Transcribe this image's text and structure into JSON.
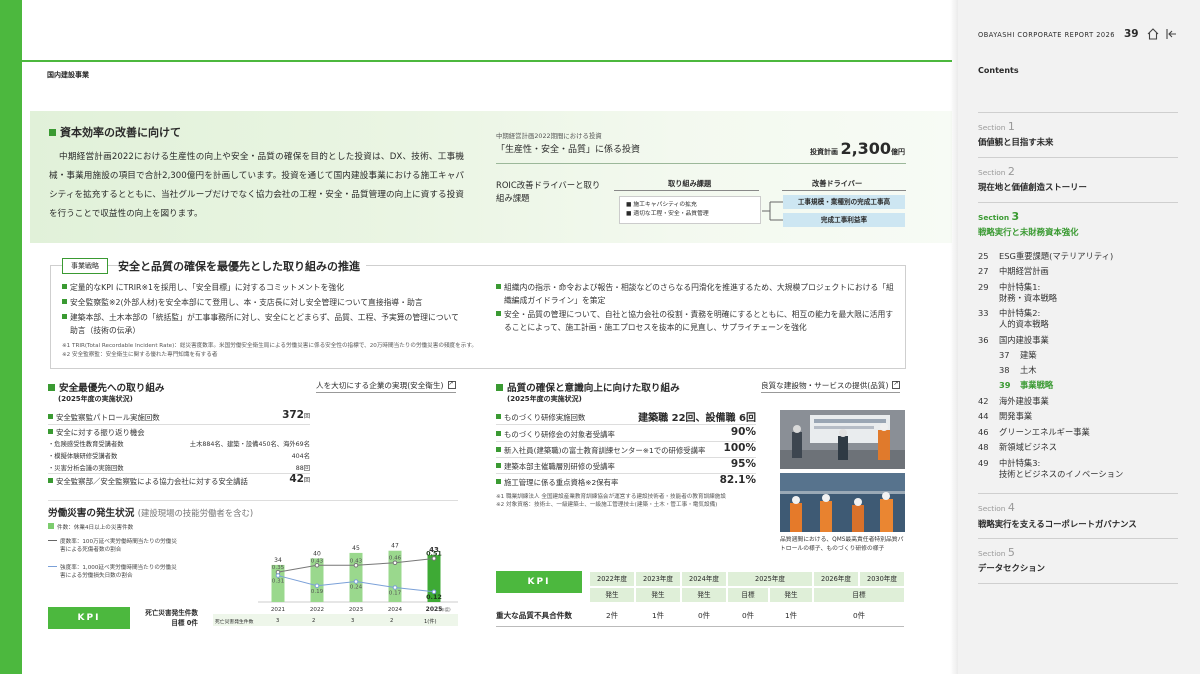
{
  "section_label": "国内建設事業",
  "investment": {
    "title": "資本効率の改善に向けて",
    "body": "中期経営計画2022における生産性の向上や安全・品質の確保を目的とした投資は、DX、技術、工事機械・事業用施設の項目で合計2,300億円を計画しています。投資を通じて国内建設事業における施工キャパシティを拡充するとともに、当社グループだけでなく協力会社の工程・安全・品質管理の向上に資する投資を行うことで収益性の向上を図ります。",
    "caption": "中期経営計画2022期間における投資",
    "heading": "「生産性・安全・品質」に係る投資",
    "plan_label": "投資計画",
    "plan_value": "2,300",
    "plan_unit": "億円",
    "roic_title": "ROIC改善ドライバーと取り組み課題",
    "col_issue": "取り組み課題",
    "col_driver": "改善ドライバー",
    "issues": [
      "施工キャパシティの拡充",
      "適切な工程・安全・品質管理"
    ],
    "drivers": [
      "工事規模・業種別の完成工事高",
      "完成工事利益率"
    ]
  },
  "strategy": {
    "tag": "事業戦略",
    "title": "安全と品質の確保を最優先とした取り組みの推進",
    "left_bullets": [
      "定量的なKPI にTRIR※1を採用し、「安全目標」に対するコミットメントを強化",
      "安全監察監※2(外部人材)を安全本部にて登用し、本・支店長に対し安全管理について直接指導・助言",
      "建築本部、土木本部の「統括監」が工事事務所に対し、安全にとどまらず、品質、工程、予実算の管理について助言（技術の伝承）"
    ],
    "right_bullets": [
      "組織内の指示・命令および報告・相談などのさらなる円滑化を推進するため、大規模プロジェクトにおける「組織編成ガイドライン」を策定",
      "安全・品質の管理について、自社と協力会社の役割・責務を明確にするとともに、相互の能力を最大限に活用することによって、施工計画・施工プロセスを抜本的に見直し、サプライチェーンを強化"
    ],
    "notes": [
      "※1 TRIR(Total Recordable Incident Rate)：総災害度数率。米国労働安全衛生局による労働災害に係る安全性の指標で、20万時間当たりの労働災害の頻度を示す。",
      "※2 安全監察監：安全衛生に関する優れた専門知識を有する者"
    ]
  },
  "safety": {
    "title": "安全最優先への取り組み",
    "subtitle": "(2025年度の実施状況)",
    "link": "人を大切にする企業の実現(安全衛生)",
    "rows": [
      {
        "label": "安全監察監パトロール実施回数",
        "value": "372",
        "unit": "回"
      },
      {
        "label": "安全に対する振り返り機会",
        "value": "",
        "unit": ""
      },
      {
        "label": "安全監察部／安全監察監による協力会社に対する安全講話",
        "value": "42",
        "unit": "回"
      }
    ],
    "subrows": [
      {
        "label": "・危険感受性教育受講者数",
        "value": "土木884名、建築・設備450名、海外69名"
      },
      {
        "label": "・模擬体験研修受講者数",
        "value": "404名"
      },
      {
        "label": "・災害分析会議の実施回数",
        "value": "88回"
      }
    ]
  },
  "accident": {
    "title": "労働災害の発生状況",
    "title_note": "(建設現場の技能労働者を含む)",
    "legend": [
      "件数：休業4日以上の災害件数",
      "度数率：100万延べ実労働時間当たりの労働災害による死傷者数の割合",
      "強度率：1,000延べ実労働時間当たりの労働災害による労働損失日数の割合"
    ],
    "x_unit": "(年度)",
    "fatal_label": "死亡災害発生件数",
    "fatal_values": [
      "3",
      "2",
      "3",
      "2",
      "1(件)"
    ]
  },
  "chart_data": {
    "type": "bar",
    "categories": [
      "2021",
      "2022",
      "2023",
      "2024",
      "2025"
    ],
    "series": [
      {
        "name": "件数",
        "type": "bar",
        "values": [
          34,
          40,
          45,
          47,
          43
        ]
      },
      {
        "name": "度数率",
        "type": "line",
        "values": [
          0.35,
          0.43,
          0.43,
          0.46,
          0.51
        ]
      },
      {
        "name": "強度率",
        "type": "line",
        "values": [
          0.31,
          0.19,
          0.24,
          0.17,
          0.12
        ]
      }
    ],
    "title": "労働災害の発生状況",
    "xlabel": "",
    "ylabel": ""
  },
  "kpi_left": {
    "label": "KPI",
    "text_1": "死亡災害発生件数",
    "text_2": "目標 0件"
  },
  "quality": {
    "title": "品質の確保と意識向上に向けた取り組み",
    "subtitle": "(2025年度の実施状況)",
    "link": "良質な建設物・サービスの提供(品質)",
    "rows": [
      {
        "label": "ものづくり研修実施回数",
        "value": "建築職 22回、設備職 6回"
      },
      {
        "label": "ものづくり研修会の対象者受講率",
        "value": "90%"
      },
      {
        "label": "新入社員(建築職)の富士教育訓練センター※1での研修受講率",
        "value": "100%"
      },
      {
        "label": "建築本部主催職層別研修の受講率",
        "value": "95%"
      },
      {
        "label": "施工管理に係る重点資格※2保有率",
        "value": "82.1%"
      }
    ],
    "notes": [
      "※1 職業訓練法人 全国建設産業教育訓練協会が運営する建設技術者・技能者の教育訓練施設",
      "※2 対象資格：技術士、一級建築士、一級施工管理技士(建築・土木・管工事・電気設備)"
    ],
    "photo_caption": "品質週間における、QMS最高責任者特別品質パトロールの様子、ものづくり研修の様子"
  },
  "kpi_table": {
    "label": "KPI",
    "years": [
      "2022年度",
      "2023年度",
      "2024年度",
      "2025年度",
      "2026年度",
      "2030年度"
    ],
    "sub_headers": [
      "発生",
      "発生",
      "発生",
      "目標",
      "発生",
      "目標"
    ],
    "row_label": "重大な品質不具合件数",
    "values": [
      "2件",
      "1件",
      "0件",
      "0件",
      "1件",
      "0件"
    ]
  },
  "sidebar": {
    "report_name": "OBAYASHI CORPORATE REPORT 2026",
    "page_number": "39",
    "contents": "Contents",
    "sections": [
      {
        "label": "Section",
        "num": "1",
        "title": "価値観と目指す未来"
      },
      {
        "label": "Section",
        "num": "2",
        "title": "現在地と価値創造ストーリー"
      },
      {
        "label": "Section",
        "num": "3",
        "title": "戦略実行と未財務資本強化"
      },
      {
        "label": "Section",
        "num": "4",
        "title": "戦略実行を支えるコーポレートガバナンス"
      },
      {
        "label": "Section",
        "num": "5",
        "title": "データセクション"
      }
    ],
    "toc": [
      {
        "page": "25",
        "title": "ESG重要課題(マテリアリティ)"
      },
      {
        "page": "27",
        "title": "中期経営計画"
      },
      {
        "page": "29",
        "title": "中計特集1:"
      },
      {
        "page": "",
        "title": "財務・資本戦略"
      },
      {
        "page": "33",
        "title": "中計特集2:"
      },
      {
        "page": "",
        "title": "人的資本戦略"
      },
      {
        "page": "36",
        "title": "国内建設事業"
      },
      {
        "page": "37",
        "title": "建築"
      },
      {
        "page": "38",
        "title": "土木"
      },
      {
        "page": "39",
        "title": "事業戦略"
      },
      {
        "page": "42",
        "title": "海外建設事業"
      },
      {
        "page": "44",
        "title": "開発事業"
      },
      {
        "page": "46",
        "title": "グリーンエネルギー事業"
      },
      {
        "page": "48",
        "title": "新領域ビジネス"
      },
      {
        "page": "49",
        "title": "中計特集3:"
      },
      {
        "page": "",
        "title": "技術とビジネスのイノベーション"
      }
    ]
  }
}
